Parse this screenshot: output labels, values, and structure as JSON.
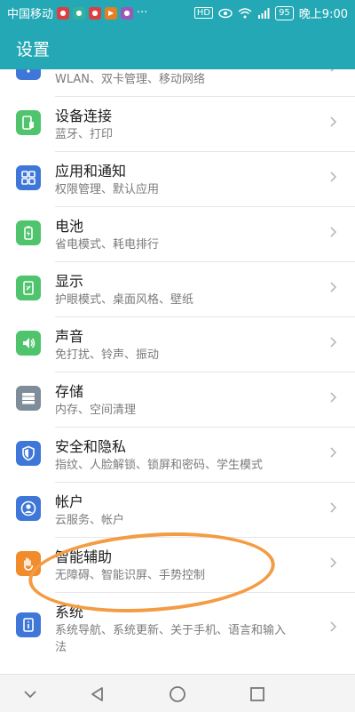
{
  "status": {
    "carrier": "中国移动",
    "battery": "95",
    "time": "晚上9:00",
    "hd_label": "HD",
    "dots": "···"
  },
  "header": {
    "title": "设置"
  },
  "partial_item": {
    "subtitle": "WLAN、双卡管理、移动网络"
  },
  "items": [
    {
      "title": "设备连接",
      "subtitle": "蓝牙、打印",
      "icon": "device-connect-icon",
      "color": "#4fc46c"
    },
    {
      "title": "应用和通知",
      "subtitle": "权限管理、默认应用",
      "icon": "apps-icon",
      "color": "#3f77d9"
    },
    {
      "title": "电池",
      "subtitle": "省电模式、耗电排行",
      "icon": "battery-icon",
      "color": "#4fc46c"
    },
    {
      "title": "显示",
      "subtitle": "护眼模式、桌面风格、壁纸",
      "icon": "display-icon",
      "color": "#4fc46c"
    },
    {
      "title": "声音",
      "subtitle": "免打扰、铃声、振动",
      "icon": "sound-icon",
      "color": "#4fc46c"
    },
    {
      "title": "存储",
      "subtitle": "内存、空间清理",
      "icon": "storage-icon",
      "color": "#7f8c99"
    },
    {
      "title": "安全和隐私",
      "subtitle": "指纹、人脸解锁、锁屏和密码、学生模式",
      "icon": "security-icon",
      "color": "#3f77d9"
    },
    {
      "title": "帐户",
      "subtitle": "云服务、帐户",
      "icon": "account-icon",
      "color": "#3f77d9"
    },
    {
      "title": "智能辅助",
      "subtitle": "无障碍、智能识屏、手势控制",
      "icon": "accessibility-icon",
      "color": "#f08c2c"
    },
    {
      "title": "系统",
      "subtitle_line1": "系统导航、系统更新、关于手机、语言和输入",
      "subtitle_line2": "法",
      "icon": "system-icon",
      "color": "#3f77d9"
    }
  ],
  "annotation": {
    "color": "#f39c43"
  }
}
